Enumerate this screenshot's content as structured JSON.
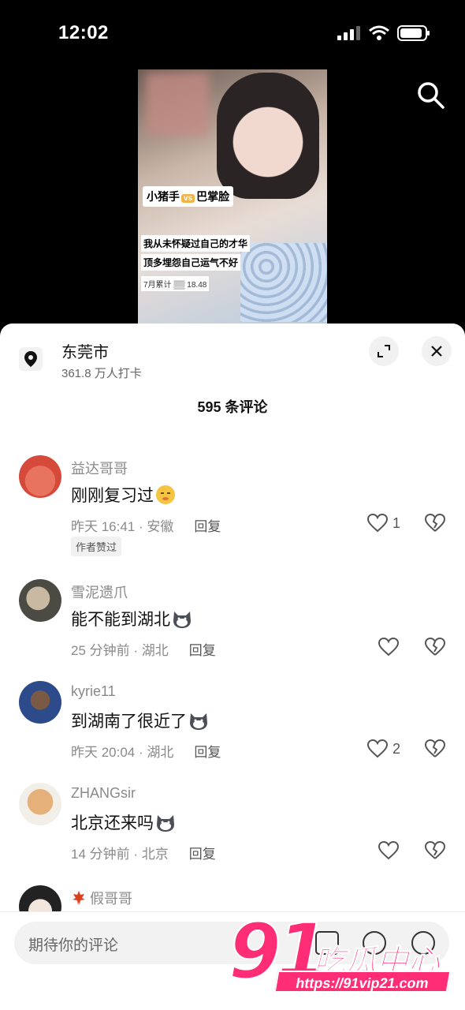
{
  "status": {
    "time": "12:02"
  },
  "video": {
    "tag_left": "小猪手",
    "tag_vs": "vs",
    "tag_right": "巴掌脸",
    "caption_line1": "我从未怀疑过自己的才华",
    "caption_line2": "顶多埋怨自己运气不好",
    "mini_label": "7月累计",
    "mini_value": "18.48"
  },
  "location": {
    "name": "东莞市",
    "subtitle": "361.8 万人打卡"
  },
  "comments_title": "595 条评论",
  "comments": [
    {
      "user": "益达哥哥",
      "text": "刚刚复习过",
      "emoji": "shy-face-emoji",
      "meta": "昨天 16:41 · 安徽",
      "reply": "回复",
      "likes": "1",
      "badge": "作者赞过",
      "avatar_color": "#d64a3c"
    },
    {
      "user": "雪泥遗爪",
      "text": "能不能到湖北",
      "emoji": "husky-emoji",
      "meta": "25 分钟前 · 湖北",
      "reply": "回复",
      "likes": "",
      "avatar_color": "#4b4b44"
    },
    {
      "user": "kyrie11",
      "text": "到湖南了很近了",
      "emoji": "husky-emoji",
      "meta": "昨天 20:04 · 湖北",
      "reply": "回复",
      "likes": "2",
      "avatar_color": "#2d4a8a"
    },
    {
      "user": "ZHANGsir",
      "text": "北京还来吗",
      "emoji": "husky-emoji",
      "meta": "14 分钟前 · 北京",
      "reply": "回复",
      "likes": "",
      "avatar_color": "#e6b07a"
    },
    {
      "user": "假哥哥",
      "avatar_color": "#222"
    }
  ],
  "input": {
    "placeholder": "期待你的评论"
  },
  "watermark": {
    "num": "91",
    "cn": "吃瓜中心",
    "url": "https://91vip21.com"
  }
}
